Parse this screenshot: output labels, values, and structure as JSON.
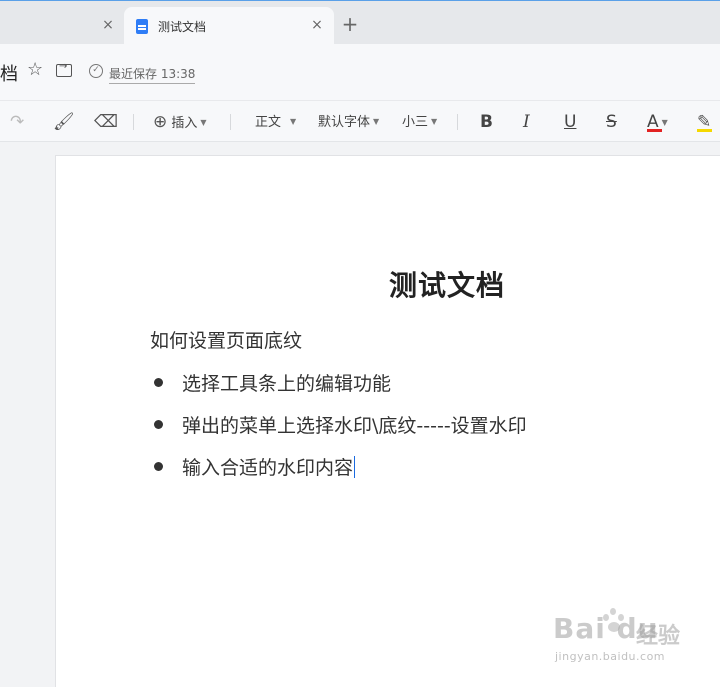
{
  "tabs": {
    "active_title": "测试文档",
    "close_glyph": "×",
    "new_tab_glyph": "+"
  },
  "titlebar": {
    "doc_name_fragment": "档",
    "save_status": "最近保存 13:38"
  },
  "toolbar": {
    "insert_label": "插入",
    "style_label": "正文",
    "font_label": "默认字体",
    "size_label": "小三",
    "bold_label": "B",
    "italic_label": "I",
    "underline_label": "U",
    "strike_label": "S",
    "font_color_label": "A",
    "font_color": "#e22222",
    "highlight_color": "#f5d800"
  },
  "document": {
    "title": "测试文档",
    "paragraph": "如何设置页面底纹",
    "bullets": [
      "选择工具条上的编辑功能",
      "弹出的菜单上选择水印\\底纹-----设置水印",
      "输入合适的水印内容"
    ]
  },
  "watermark": {
    "logo": "Bai du",
    "chinese": "经验",
    "url": "jingyan.baidu.com"
  },
  "colors": {
    "accent": "#2f7df6",
    "tabbar_bg": "#e6e8eb",
    "page_bg": "#ffffff"
  }
}
